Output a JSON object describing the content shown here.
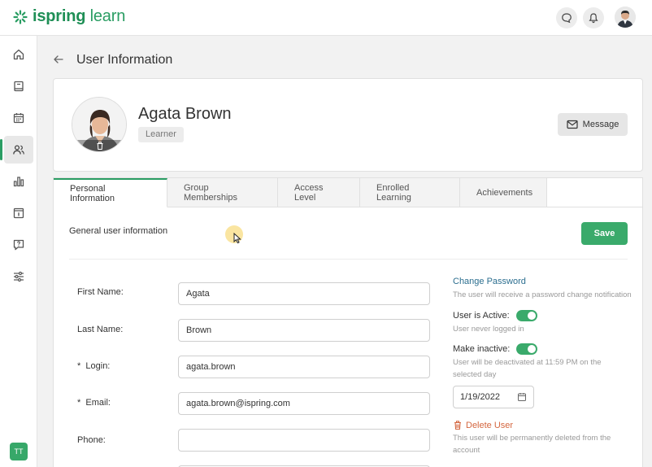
{
  "app": {
    "logo_text": "ispring",
    "logo_suffix": "learn",
    "brand_color": "#2a9d63"
  },
  "topbar": {
    "chat_icon": "chat-bubble-icon",
    "bell_icon": "bell-icon"
  },
  "sidebar": {
    "items": [
      {
        "icon": "home-icon"
      },
      {
        "icon": "book-icon"
      },
      {
        "icon": "calendar-icon"
      },
      {
        "icon": "users-icon",
        "active": true
      },
      {
        "icon": "chart-icon"
      },
      {
        "icon": "info-icon"
      },
      {
        "icon": "question-icon"
      },
      {
        "icon": "sliders-icon"
      }
    ],
    "user_initials": "TT"
  },
  "header": {
    "title": "User Information"
  },
  "profile": {
    "name": "Agata Brown",
    "role": "Learner",
    "message_label": "Message"
  },
  "tabs": [
    {
      "label": "Personal Information",
      "active": true
    },
    {
      "label": "Group Memberships"
    },
    {
      "label": "Access Level"
    },
    {
      "label": "Enrolled Learning"
    },
    {
      "label": "Achievements"
    }
  ],
  "form": {
    "section_label": "General user information",
    "save_label": "Save",
    "fields": [
      {
        "label": "First Name:",
        "value": "Agata"
      },
      {
        "label": "Last Name:",
        "value": "Brown"
      },
      {
        "label": "*  Login:",
        "value": "agata.brown"
      },
      {
        "label": "*  Email:",
        "value": "agata.brown@ispring.com"
      },
      {
        "label": "Phone:",
        "value": ""
      }
    ]
  },
  "account": {
    "change_password": "Change Password",
    "change_password_hint": "The user will receive a password change notification",
    "active_label": "User is Active:",
    "active_hint": "User never logged in",
    "inactive_label": "Make inactive:",
    "inactive_hint": "User will be deactivated at 11:59 PM on the selected day",
    "date_value": "1/19/2022",
    "delete_label": "Delete User",
    "delete_hint": "This user will be permanently deleted from the account"
  }
}
